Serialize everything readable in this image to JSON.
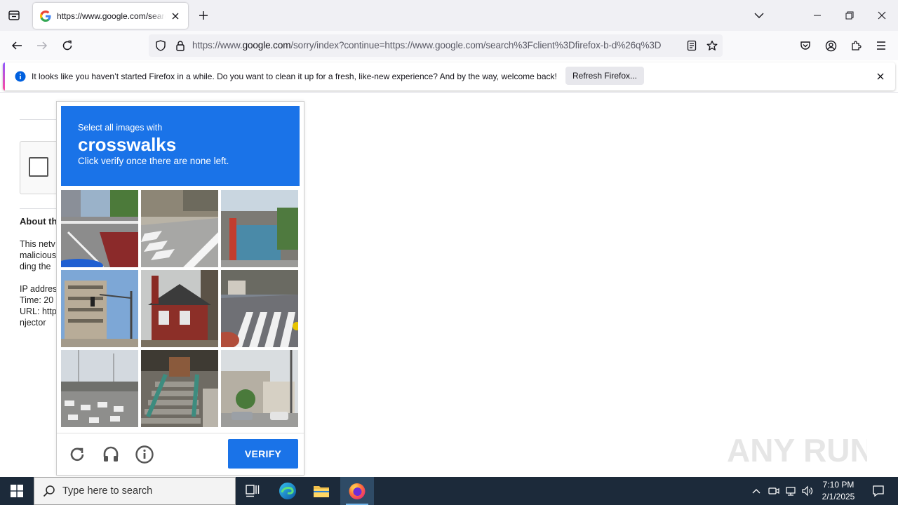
{
  "browser": {
    "tab": {
      "title": "https://www.google.com/search?client=firefox-b-d&q="
    },
    "url": {
      "prefix": "https://www.",
      "domain": "google.com",
      "path": "/sorry/index?continue=https://www.google.com/search%3Fclient%3Dfirefox-b-d%26q%3D"
    }
  },
  "notification": {
    "text": "It looks like you haven’t started Firefox in a while. Do you want to clean it up for a fresh, like-new experience? And by the way, welcome back!",
    "button_label": "Refresh Firefox..."
  },
  "page": {
    "about_title": "About th",
    "lines": [
      "This netv",
      "malicious",
      "ding the",
      "",
      "IP addres",
      "Time: 20",
      "URL: http",
      "njector"
    ]
  },
  "captcha": {
    "instruction_small": "Select all images with",
    "target": "crosswalks",
    "instruction_sub": "Click verify once there are none left.",
    "verify_label": "VERIFY"
  },
  "watermark": {
    "text": "ANY RUN"
  },
  "taskbar": {
    "search_placeholder": "Type here to search",
    "time": "7:10 PM",
    "date": "2/1/2025"
  },
  "colors": {
    "accent": "#1a73e8",
    "taskbar": "#1c2a3a",
    "tabstrip": "#f0f0f4"
  }
}
